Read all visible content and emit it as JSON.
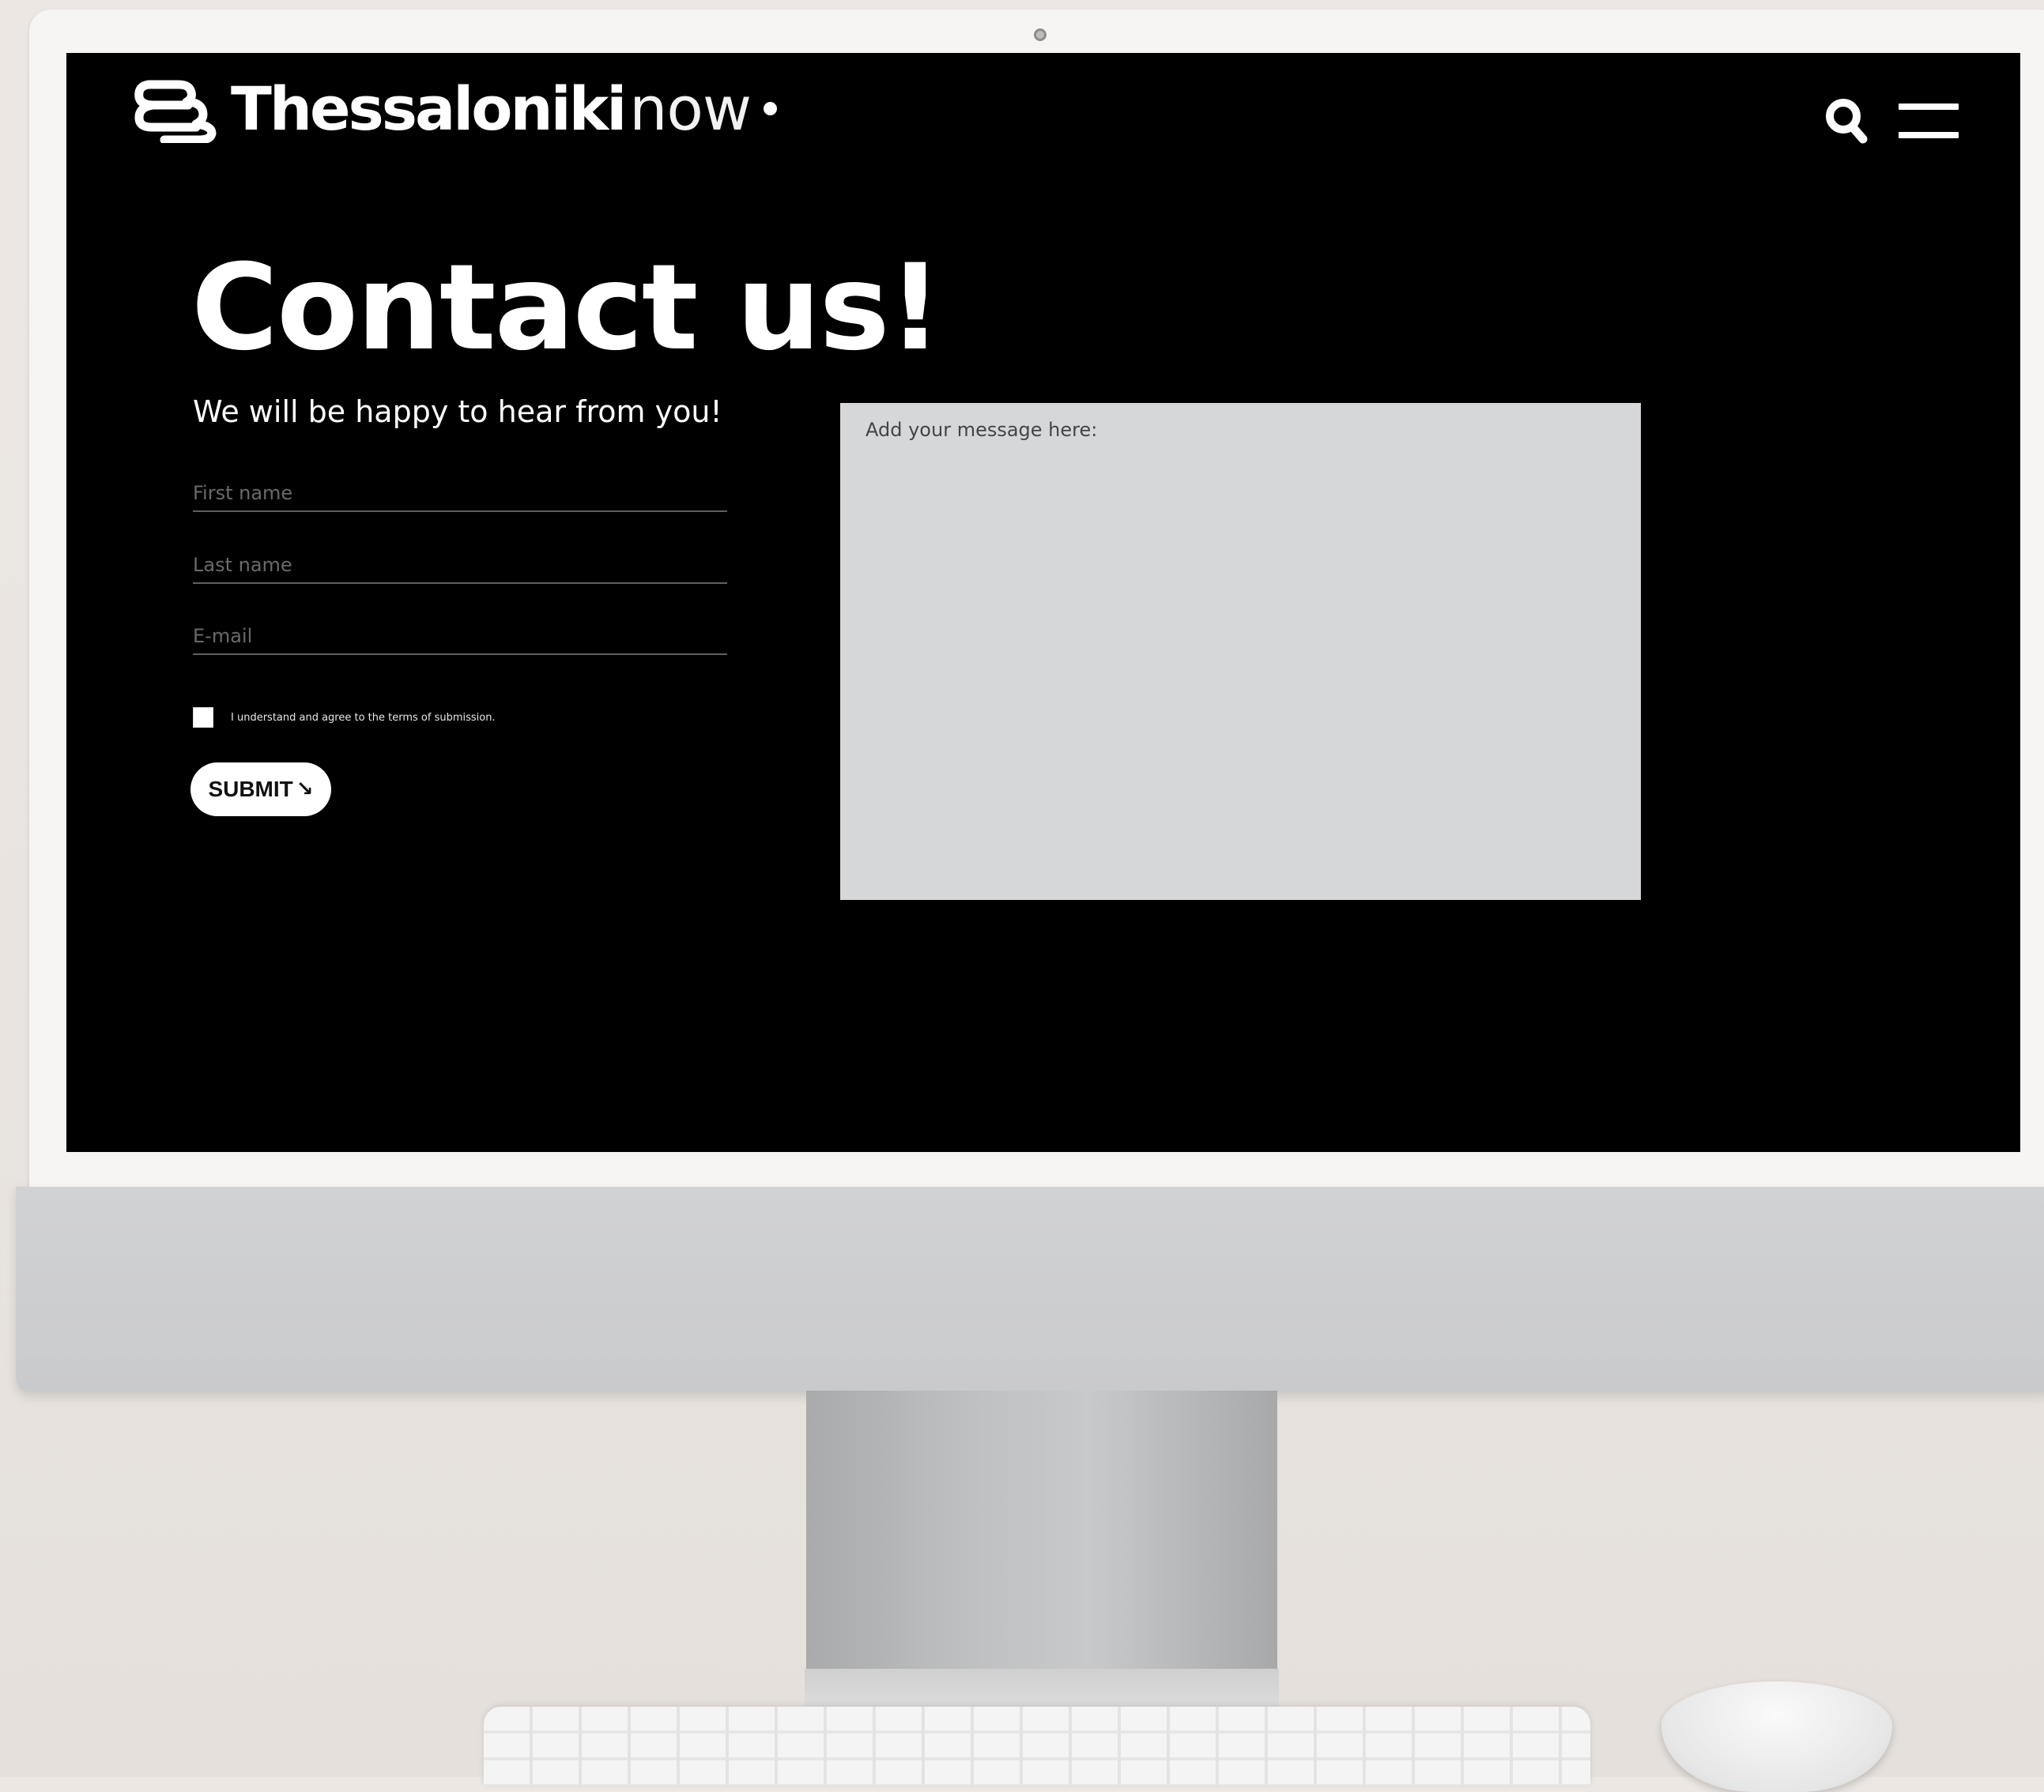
{
  "header": {
    "logo_bold": "Thessaloniki",
    "logo_light": "now",
    "icons": {
      "logo": "thessaloniki-logo-mark",
      "search": "search-icon",
      "menu": "hamburger-menu-icon"
    }
  },
  "contact": {
    "title": "Contact us!",
    "subtitle": "We will be happy to hear from you!",
    "first_name_placeholder": "First name",
    "last_name_placeholder": "Last name",
    "email_placeholder": "E-mail",
    "terms_label": "I understand and agree to the terms of submission.",
    "submit_label": "SUBMIT",
    "submit_icon": "↘",
    "message_placeholder": "Add your message here:"
  },
  "colors": {
    "screen_bg": "#000000",
    "text": "#ffffff",
    "message_bg": "#d6d7d9",
    "field_line": "#5f5f5f"
  }
}
